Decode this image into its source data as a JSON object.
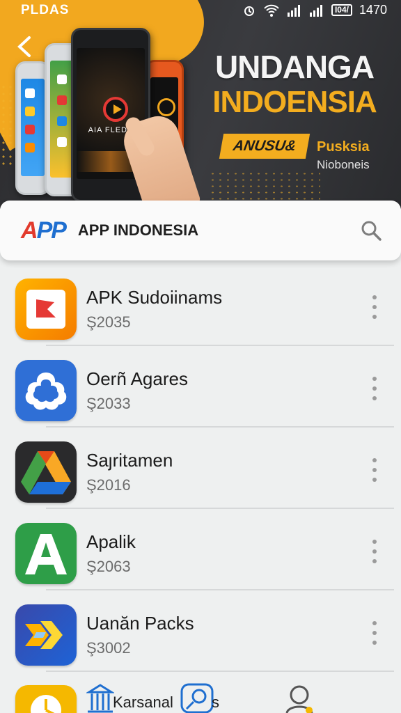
{
  "status_bar": {
    "brand": "PLDAS",
    "time": "1470",
    "battery": "I04/"
  },
  "hero": {
    "headline_line1": "UNDANGA",
    "headline_line2": "INDOENSIA",
    "tag_label": "ANUSU&",
    "side_line1": "Pusksia",
    "side_line2": "Nioboneis",
    "phone_text": "AIA FLEDA"
  },
  "search": {
    "logo_part1": "A",
    "logo_part2": "PP",
    "title": "APP INDONESIA"
  },
  "apps": [
    {
      "name": "APK Sudoiinams",
      "subtitle": "Ş2035",
      "icon": "red-bookmark-icon"
    },
    {
      "name": "Oerñ Agares",
      "subtitle": "Ş2033",
      "icon": "blue-cloud-icon"
    },
    {
      "name": "Saȷritamen",
      "subtitle": "Ş2016",
      "icon": "drive-triangle-icon"
    },
    {
      "name": "Apalik",
      "subtitle": "Ş2063",
      "icon": "green-a-icon"
    },
    {
      "name": "Uanăn Packs",
      "subtitle": "Ş3002",
      "icon": "blue-arrow-icon"
    }
  ],
  "bottom": {
    "label": "Karsanal",
    "label_suffix": "s"
  },
  "colors": {
    "accent": "#f3ad1f",
    "hero_bg": "#2f3033",
    "list_bg": "#eef0f0"
  }
}
